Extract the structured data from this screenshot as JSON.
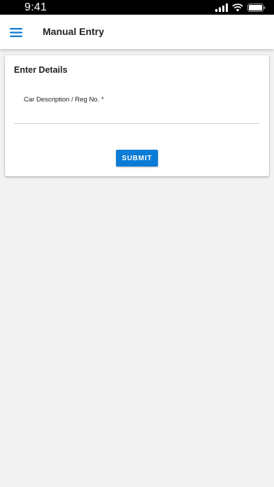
{
  "status_bar": {
    "time": "9:41",
    "icons": [
      "signal-icon",
      "wifi-icon",
      "battery-icon"
    ]
  },
  "app_bar": {
    "menu_icon": "menu-icon",
    "title": "Manual Entry"
  },
  "form": {
    "heading": "Enter Details",
    "car_field": {
      "label": "Car Description / Reg No. *",
      "value": ""
    },
    "submit_label": "SUBMIT"
  },
  "colors": {
    "accent": "#0a7bd6",
    "background": "#f2f2f2",
    "card": "#ffffff",
    "status_bar": "#000000"
  }
}
